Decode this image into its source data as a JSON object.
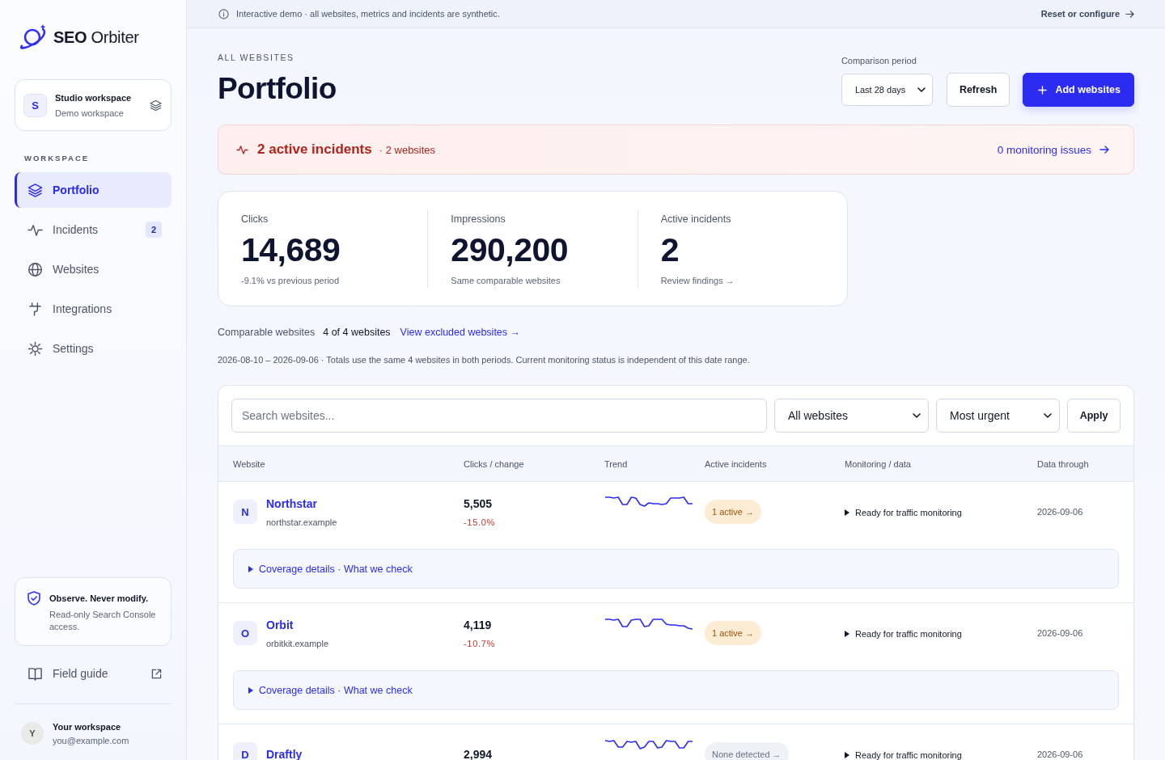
{
  "sidebar": {
    "logo": "**SEO** Orbiter",
    "workspace": {
      "initial": "S",
      "name": "Studio workspace",
      "subtitle": "Demo workspace"
    },
    "section_label": "WORKSPACE",
    "nav": [
      {
        "label": "Portfolio",
        "selected": true
      },
      {
        "label": "Incidents",
        "selected": false,
        "badge": "2"
      },
      {
        "label": "Websites",
        "selected": false
      },
      {
        "label": "Integrations",
        "selected": false
      },
      {
        "label": "Settings",
        "selected": false
      }
    ],
    "note": {
      "title": "Observe. Never modify.",
      "text": "Read-only Search Console access."
    },
    "field_guide": "Field guide",
    "user": {
      "initial": "Y",
      "name": "Your workspace",
      "email": "you@example.com"
    }
  },
  "demo_banner": {
    "text": "Interactive demo · all websites, metrics and incidents are synthetic.",
    "link": "Reset or configure"
  },
  "header": {
    "eyebrow": "ALL WEBSITES",
    "title": "Portfolio",
    "period_label": "Comparison period",
    "period": "Last 28 days",
    "refresh": "Refresh",
    "add": "Add websites"
  },
  "incident_banner": {
    "title": "2 active incidents",
    "detail": "· 2 websites",
    "link": "0 monitoring issues"
  },
  "stats": [
    {
      "label": "Clicks",
      "value": "14,689",
      "note": "-9.1% vs previous period"
    },
    {
      "label": "Impressions",
      "value": "290,200",
      "note": "Same comparable websites"
    },
    {
      "label": "Active incidents",
      "value": "2",
      "action": "Review findings →"
    }
  ],
  "comparable": {
    "label": "Comparable websites",
    "count": "4 of 4 websites",
    "link": "View excluded websites →"
  },
  "date_note": "2026-08-10 – 2026-09-06 · Totals use the same 4 websites in both periods. Current monitoring status is independent of this date range.",
  "table": {
    "search_placeholder": "Search websites...",
    "filter": "All websites",
    "sort": "Most urgent",
    "apply": "Apply",
    "columns": [
      "Website",
      "Clicks / change",
      "Trend",
      "Active incidents",
      "Monitoring / data",
      "Data through"
    ],
    "rows": [
      {
        "initial": "N",
        "name": "Northstar",
        "domain": "northstar.example",
        "clicks": "5,505",
        "change": "-15.0%",
        "incidents": {
          "kind": "active",
          "label": "1 active →"
        },
        "monitoring": {
          "label": "Ready for traffic monitoring",
          "expanded": false
        },
        "data_through": "2026-09-06",
        "coverage": {
          "label": "Coverage details · What we check",
          "expanded": false
        }
      },
      {
        "initial": "O",
        "name": "Orbit",
        "domain": "orbitkit.example",
        "clicks": "4,119",
        "change": "-10.7%",
        "incidents": {
          "kind": "active",
          "label": "1 active →"
        },
        "monitoring": {
          "label": "Ready for traffic monitoring",
          "expanded": false
        },
        "data_through": "2026-09-06",
        "coverage": {
          "label": "Coverage details · What we check",
          "expanded": false
        }
      },
      {
        "initial": "D",
        "name": "Draftly",
        "clicks": "2,994",
        "incidents": {
          "kind": "none",
          "label": "None detected →"
        },
        "monitoring": {
          "label": "Ready for traffic monitoring",
          "expanded": false
        },
        "data_through": "2026-09-06"
      }
    ]
  }
}
